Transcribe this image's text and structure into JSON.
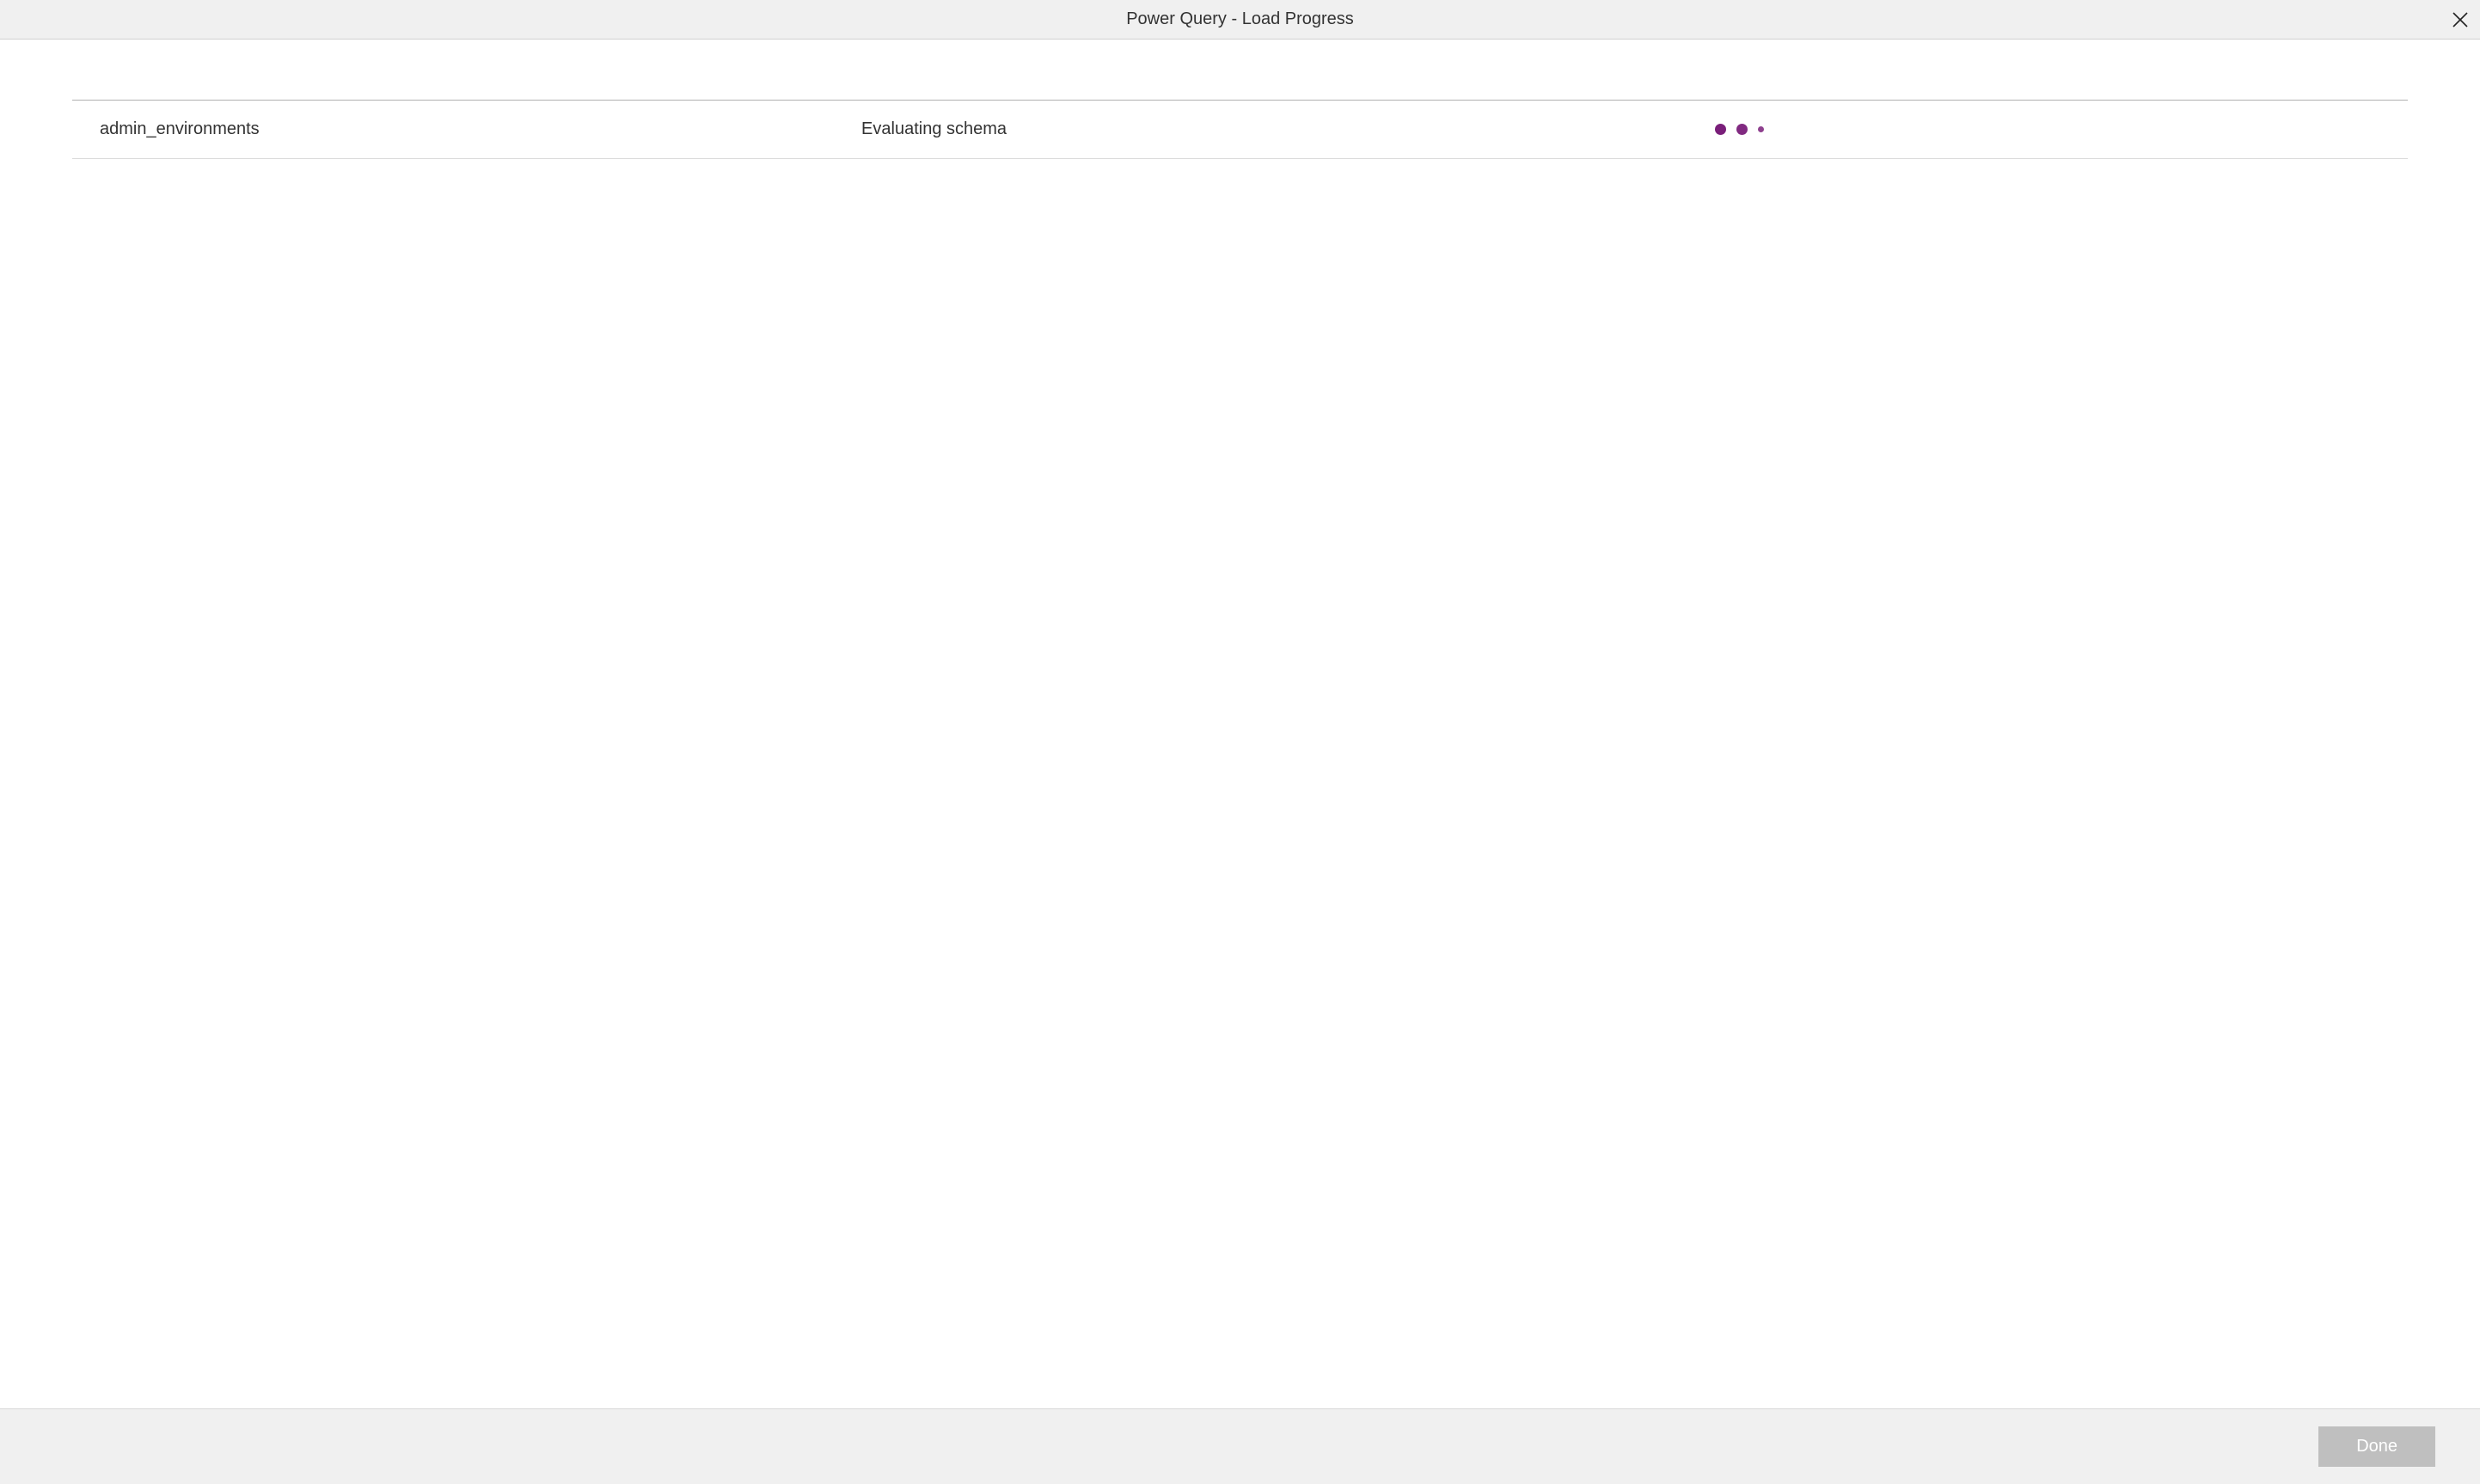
{
  "titlebar": {
    "title": "Power Query - Load Progress"
  },
  "rows": [
    {
      "name": "admin_environments",
      "status": "Evaluating schema"
    }
  ],
  "footer": {
    "done_label": "Done"
  },
  "colors": {
    "spinner": "#7a1f7a",
    "titlebar_bg": "#f0f0f0",
    "footer_bg": "#f0f0f0",
    "done_bg": "#bfbfbf"
  }
}
